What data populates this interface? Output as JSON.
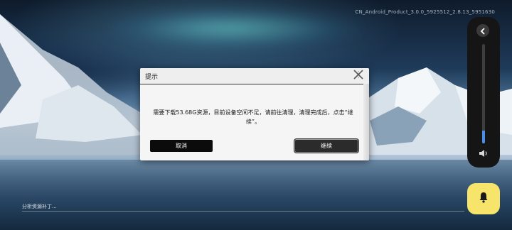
{
  "app": {
    "version": "CN_Android_Product_3.0.0_5925512_2.8.13_5951630"
  },
  "dialog": {
    "title": "提示",
    "message": "需要下载53.68G资源，目前设备空间不足，请前往清理，清理完成后，点击“继续”。",
    "cancel_label": "取消",
    "continue_label": "继续"
  },
  "status": {
    "text": "分析资源补丁...",
    "progress": 0
  },
  "overlay": {
    "volume_level": 0.13,
    "accent_color": "#4d8ee5",
    "bell_color": "#f7e46b",
    "icons": [
      "chevron-left-icon",
      "speaker-icon",
      "bell-icon",
      "close-icon"
    ]
  }
}
